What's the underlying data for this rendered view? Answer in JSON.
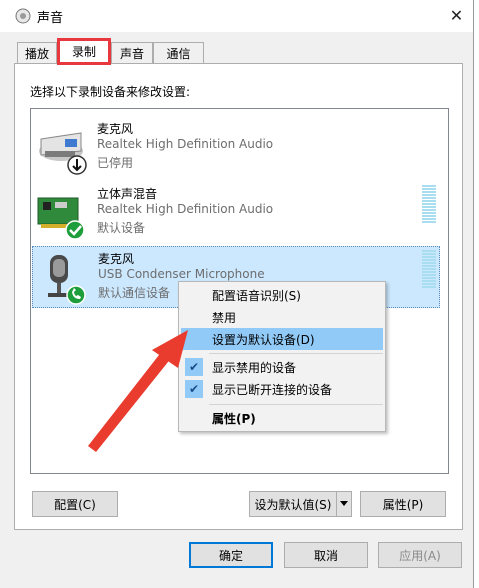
{
  "window": {
    "title": "声音",
    "close_symbol": "✕"
  },
  "tabs": [
    {
      "label": "播放"
    },
    {
      "label": "录制"
    },
    {
      "label": "声音"
    },
    {
      "label": "通信"
    }
  ],
  "panel": {
    "instruction": "选择以下录制设备来修改设置:"
  },
  "devices": [
    {
      "name": "麦克风",
      "driver": "Realtek High Definition Audio",
      "status": "已停用"
    },
    {
      "name": "立体声混音",
      "driver": "Realtek High Definition Audio",
      "status": "默认设备"
    },
    {
      "name": "麦克风",
      "driver": "USB Condenser Microphone",
      "status": "默认通信设备"
    }
  ],
  "context_menu": {
    "items": [
      {
        "label": "配置语音识别(S)"
      },
      {
        "label": "禁用"
      },
      {
        "label": "设置为默认设备(D)"
      },
      {
        "label": "显示禁用的设备"
      },
      {
        "label": "显示已断开连接的设备"
      },
      {
        "label": "属性(P)"
      }
    ]
  },
  "buttons": {
    "configure": "配置(C)",
    "set_default": "设为默认值(S)",
    "properties": "属性(P)",
    "ok": "确定",
    "cancel": "取消",
    "apply": "应用(A)"
  },
  "colors": {
    "highlight_tab": "#e8383d",
    "annotation_arrow": "#ea3b2f",
    "selection": "#cce8ff",
    "menu_highlight": "#91c9f7"
  }
}
